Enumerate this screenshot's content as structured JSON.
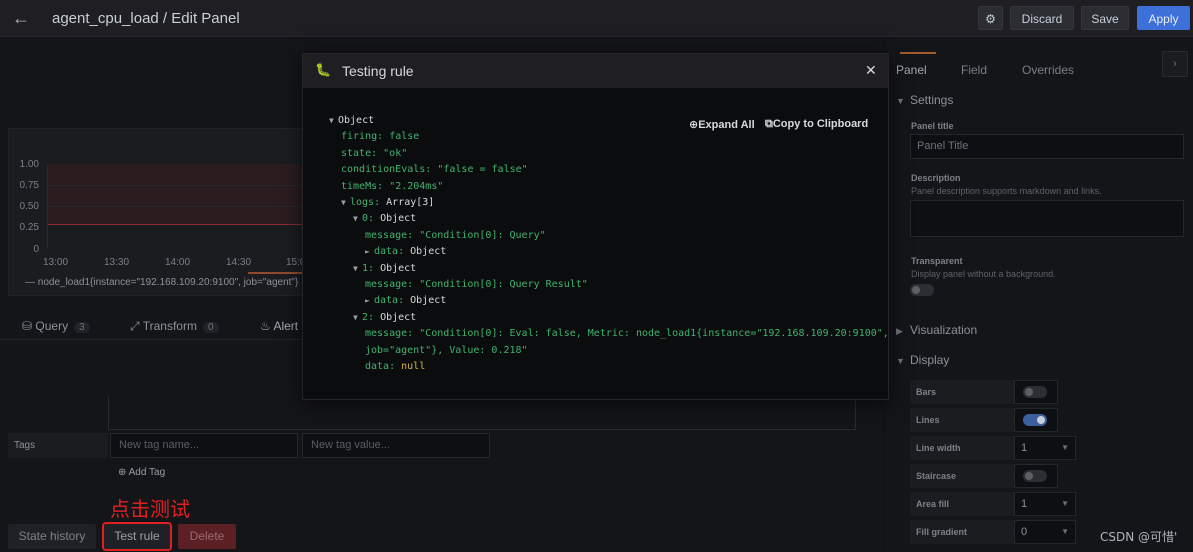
{
  "topbar": {
    "title": "agent_cpu_load / Edit Panel",
    "discard_label": "Discard",
    "save_label": "Save",
    "apply_label": "Apply"
  },
  "graph": {
    "yticks": [
      "1.00",
      "0.75",
      "0.50",
      "0.25",
      "0"
    ],
    "xticks": [
      "13:00",
      "13:30",
      "14:00",
      "14:30",
      "15:0"
    ],
    "legend": "— node_load1{instance=\"192.168.109.20:9100\", job=\"agent\"}"
  },
  "query_tabs": [
    {
      "label": "Query",
      "count": "3"
    },
    {
      "label": "Transform",
      "count": "0"
    },
    {
      "label": "Alert",
      "count": ""
    }
  ],
  "tags": {
    "label": "Tags",
    "name_placeholder": "New tag name...",
    "value_placeholder": "New tag value...",
    "add_label": "Add Tag"
  },
  "annotation_text": "点击测试",
  "bottom_buttons": {
    "history": "State history",
    "test": "Test rule",
    "delete": "Delete"
  },
  "right_pane": {
    "tabs": [
      "Panel",
      "Field",
      "Overrides"
    ],
    "settings_label": "Settings",
    "panel_title_label": "Panel title",
    "panel_title_value": "Panel Title",
    "description_label": "Description",
    "description_hint": "Panel description supports markdown and links.",
    "transparent_label": "Transparent",
    "transparent_hint": "Display panel without a background.",
    "visualization_label": "Visualization",
    "display_label": "Display",
    "display_rows": [
      {
        "label": "Bars",
        "kind": "toggle",
        "on": false
      },
      {
        "label": "Lines",
        "kind": "toggle",
        "on": true
      },
      {
        "label": "Line width",
        "kind": "select",
        "value": "1"
      },
      {
        "label": "Staircase",
        "kind": "toggle",
        "on": false
      },
      {
        "label": "Area fill",
        "kind": "select",
        "value": "1"
      },
      {
        "label": "Fill gradient",
        "kind": "select",
        "value": "0"
      }
    ]
  },
  "modal": {
    "title": "Testing rule",
    "expand_label": "Expand All",
    "copy_label": "Copy to Clipboard",
    "json": {
      "root_type": "Object",
      "firing_key": "firing:",
      "firing_val": "false",
      "state_key": "state:",
      "state_val": "\"ok\"",
      "cond_key": "conditionEvals:",
      "cond_val": "\"false = false\"",
      "time_key": "timeMs:",
      "time_val": "\"2.204ms\"",
      "logs_key": "logs:",
      "logs_type": "Array[3]",
      "i0_key": "0:",
      "i0_type": "Object",
      "i0_msg_key": "message:",
      "i0_msg_val": "\"Condition[0]: Query\"",
      "i0_data_key": "data:",
      "i0_data_type": "Object",
      "i1_key": "1:",
      "i1_type": "Object",
      "i1_msg_key": "message:",
      "i1_msg_val": "\"Condition[0]: Query Result\"",
      "i1_data_key": "data:",
      "i1_data_type": "Object",
      "i2_key": "2:",
      "i2_type": "Object",
      "i2_msg_key": "message:",
      "i2_msg_val1": "\"Condition[0]: Eval: false, Metric: node_load1{instance=\"192.168.109.20:9100\",",
      "i2_msg_val2": "job=\"agent\"}, Value: 0.218\"",
      "i2_data_key": "data:",
      "i2_data_val": "null"
    }
  },
  "watermark": "CSDN @可惜'",
  "colors": {
    "accent": "#3d71d9",
    "json_green": "#41b36f",
    "annotation_red": "#e02020"
  }
}
